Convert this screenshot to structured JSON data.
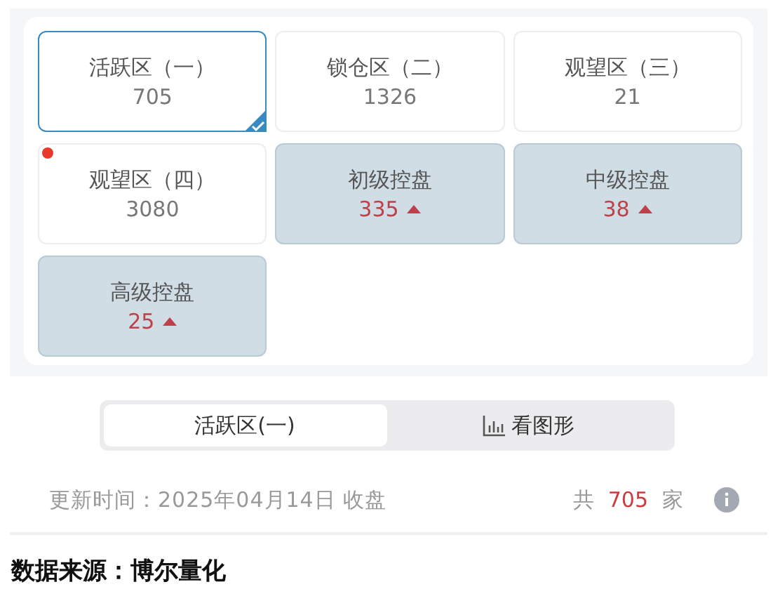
{
  "tiles": [
    {
      "kind": "zone",
      "label": "活跃区（一）",
      "value": "705",
      "selected": true,
      "alert": false
    },
    {
      "kind": "zone",
      "label": "锁仓区（二）",
      "value": "1326",
      "selected": false,
      "alert": false
    },
    {
      "kind": "zone",
      "label": "观望区（三）",
      "value": "21",
      "selected": false,
      "alert": false
    },
    {
      "kind": "zone",
      "label": "观望区（四）",
      "value": "3080",
      "selected": false,
      "alert": true
    },
    {
      "kind": "control",
      "label": "初级控盘",
      "value": "335",
      "selected": false,
      "alert": false
    },
    {
      "kind": "control",
      "label": "中级控盘",
      "value": "38",
      "selected": false,
      "alert": false
    },
    {
      "kind": "control",
      "label": "高级控盘",
      "value": "25",
      "selected": false,
      "alert": false
    }
  ],
  "segments": [
    {
      "kind": "text",
      "label": "活跃区(一)",
      "selected": true
    },
    {
      "kind": "chart",
      "label": "看图形",
      "selected": false
    }
  ],
  "update": "更新时间：2025年04月14日 收盘",
  "total": {
    "prefix": "共",
    "count": "705",
    "suffix": "家"
  },
  "source": "数据来源：博尔量化"
}
